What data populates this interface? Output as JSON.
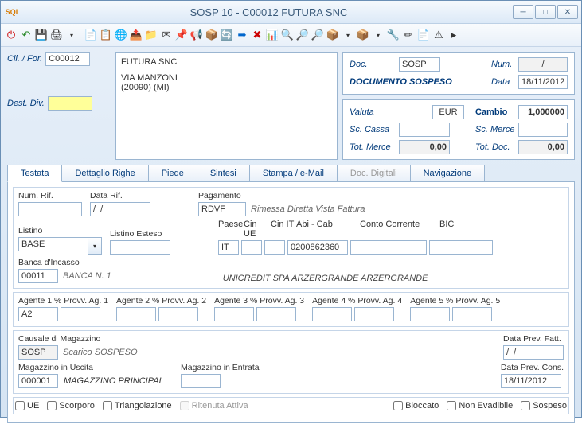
{
  "window": {
    "title": "SOSP 10 - C00012 FUTURA  SNC"
  },
  "toolbar_icons": [
    "⏻",
    "↶",
    "💾",
    "🖨",
    "▾",
    " ",
    "📄",
    "📋",
    "🌐",
    "📤",
    "📁",
    "✉",
    "📌",
    "📢",
    "📦",
    "🔄",
    "➡",
    "❌",
    "📊",
    "🔍",
    "🔎",
    "🔎",
    "📦",
    "▾",
    "📦",
    "▾",
    "🔧",
    "✏",
    "📄",
    "⚠",
    "▸"
  ],
  "header": {
    "cli_for_label": "Cli. / For.",
    "cli_for_value": "C00012",
    "dest_div_label": "Dest. Div.",
    "dest_div_value": "",
    "company_name": "FUTURA  SNC",
    "addr1": "VIA MANZONI",
    "addr2": "(20090)    (MI)",
    "doc_label": "Doc.",
    "doc_value": "SOSP",
    "num_label": "Num.",
    "num_value": "/",
    "doc_type": "DOCUMENTO SOSPESO",
    "data_label": "Data",
    "data_value": "18/11/2012",
    "valuta_label": "Valuta",
    "valuta_value": "EUR",
    "cambio_label": "Cambio",
    "cambio_value": "1,000000",
    "sc_cassa_label": "Sc. Cassa",
    "sc_cassa_value": "",
    "sc_merce_label": "Sc. Merce",
    "sc_merce_value": "",
    "tot_merce_label": "Tot. Merce",
    "tot_merce_value": "0,00",
    "tot_doc_label": "Tot. Doc.",
    "tot_doc_value": "0,00"
  },
  "tabs": [
    "Testata",
    "Dettaglio Righe",
    "Piede",
    "Sintesi",
    "Stampa / e-Mail",
    "Doc. Digitali",
    "Navigazione"
  ],
  "testata": {
    "num_rif_label": "Num. Rif.",
    "num_rif_value": "",
    "data_rif_label": "Data Rif.",
    "data_rif_value": "/  /",
    "pagamento_label": "Pagamento",
    "pagamento_value": "RDVF",
    "pagamento_desc": "Rimessa Diretta Vista Fattura",
    "listino_label": "Listino",
    "listino_value": "BASE",
    "listino_esteso_label": "Listino Esteso",
    "listino_esteso_value": "",
    "paese_label": "Paese",
    "paese_value": "IT",
    "cin_ue_label": "Cin UE",
    "cin_ue_value": "",
    "cin_it_label": "Cin IT",
    "cin_it_value": "",
    "abicab_label": "Abi - Cab",
    "abicab_value": "0200862360",
    "conto_corr_label": "Conto Corrente",
    "conto_corr_value": "",
    "bic_label": "BIC",
    "bic_value": "",
    "banca_inc_label": "Banca d'Incasso",
    "banca_inc_value": "00011",
    "banca_inc_desc": "BANCA N. 1",
    "bank_desc": "UNICREDIT SPA ARZERGRANDE ARZERGRANDE",
    "ag1_label": "Agente 1 % Provv. Ag. 1",
    "ag1_value": "A2",
    "ag1_pct": "",
    "ag2_label": "Agente 2 % Provv. Ag. 2",
    "ag3_label": "Agente 3 % Provv. Ag. 3",
    "ag4_label": "Agente 4 % Provv. Ag. 4",
    "ag5_label": "Agente 5 % Provv. Ag. 5",
    "caus_mag_label": "Causale di Magazzino",
    "caus_mag_value": "SOSP",
    "caus_mag_desc": "Scarico SOSPESO",
    "data_prev_fatt_label": "Data Prev. Fatt.",
    "data_prev_fatt_value": "/  /",
    "mag_usc_label": "Magazzino in Uscita",
    "mag_usc_value": "000001",
    "mag_usc_desc": "MAGAZZINO PRINCIPAL",
    "mag_ent_label": "Magazzino in Entrata",
    "mag_ent_value": "",
    "data_prev_cons_label": "Data Prev. Cons.",
    "data_prev_cons_value": "18/11/2012",
    "chk_ue": "UE",
    "chk_scorporo": "Scorporo",
    "chk_triang": "Triangolazione",
    "chk_ritenuta": "Ritenuta Attiva",
    "chk_bloccato": "Bloccato",
    "chk_non_evad": "Non Evadibile",
    "chk_sospeso": "Sospeso"
  }
}
